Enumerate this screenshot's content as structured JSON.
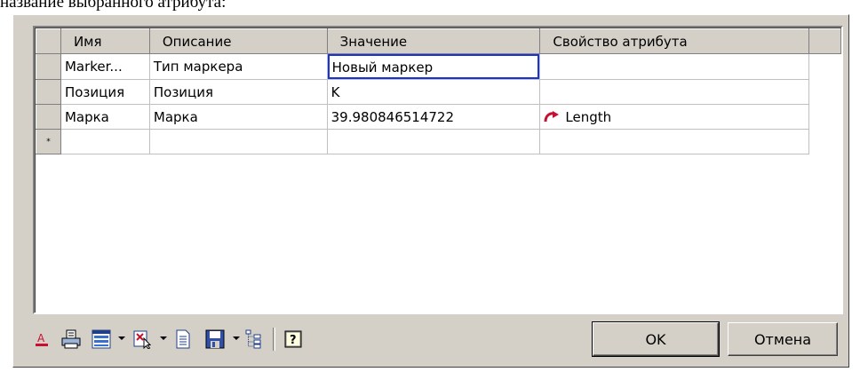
{
  "caption": "название выбранного атрибута:",
  "grid": {
    "columns": [
      "Имя",
      "Описание",
      "Значение",
      "Свойство атрибута"
    ],
    "rows": [
      {
        "name": "Marker...",
        "description": "Тип маркера",
        "value": "Новый маркер",
        "property": ""
      },
      {
        "name": "Позиция",
        "description": "Позиция",
        "value": "K",
        "property": ""
      },
      {
        "name": "Марка",
        "description": "Марка",
        "value": "39.980846514722",
        "property": "Length",
        "property_icon": "red-link-arrow-icon"
      }
    ],
    "new_row_marker": "*"
  },
  "toolbar": {
    "icons": [
      "text-color-icon",
      "print-icon",
      "layout-icon",
      "delete-icon",
      "document-icon",
      "save-icon",
      "tree-icon",
      "help-icon"
    ]
  },
  "buttons": {
    "ok": "OK",
    "cancel": "Отмена"
  },
  "colors": {
    "dialog_bg": "#d4d0c8",
    "edit_border": "#1a33d8",
    "link_arrow": "#c8102e"
  }
}
